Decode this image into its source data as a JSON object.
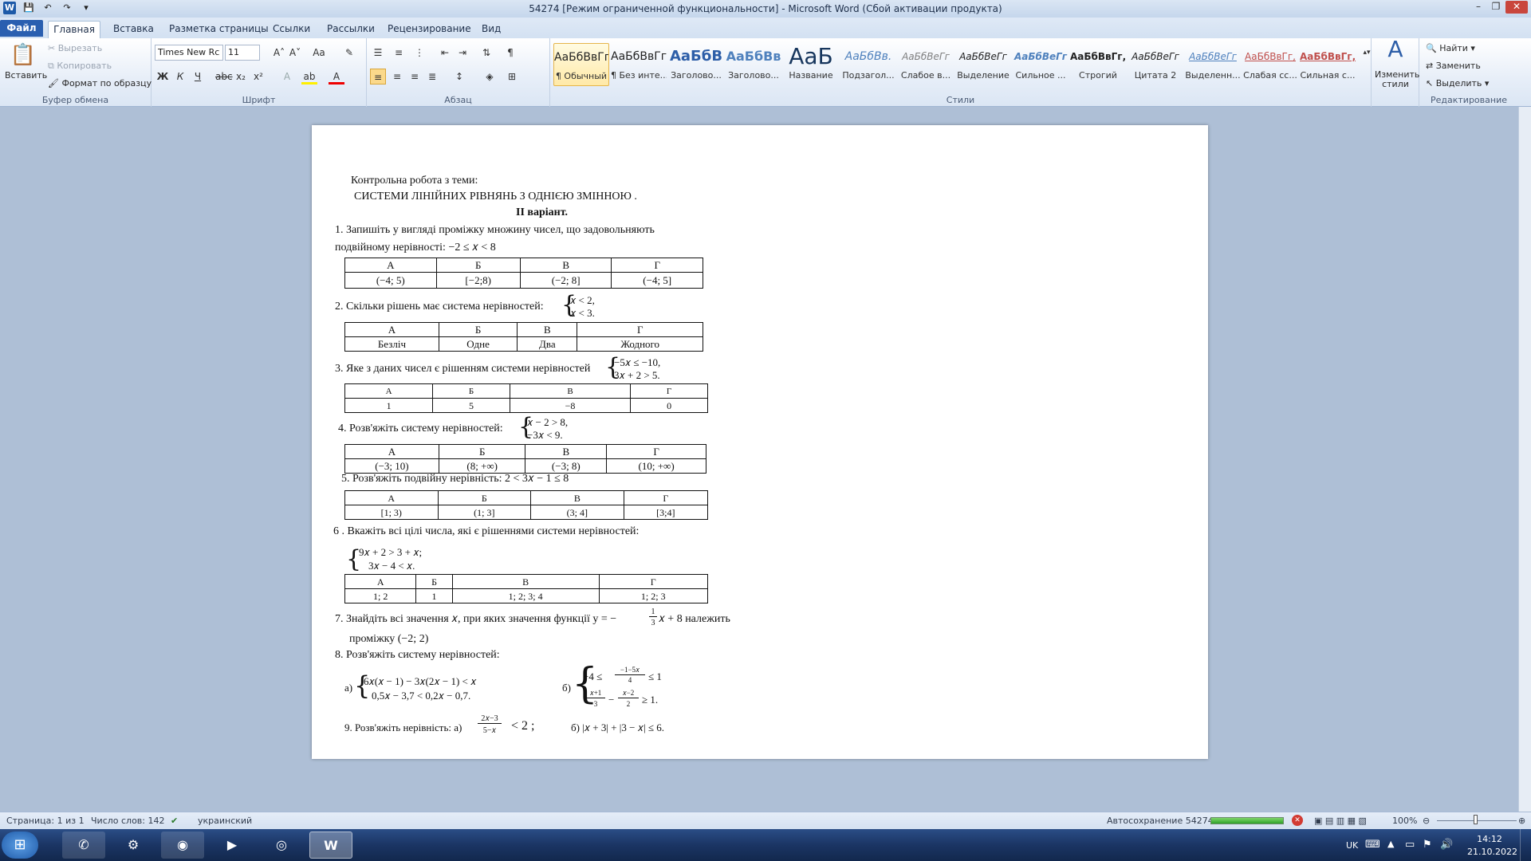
{
  "window": {
    "title": "54274 [Режим ограниченной функциональности] - Microsoft Word (Сбой активации продукта)"
  },
  "tabs": [
    "Файл",
    "Главная",
    "Вставка",
    "Разметка страницы",
    "Ссылки",
    "Рассылки",
    "Рецензирование",
    "Вид"
  ],
  "clipboard": {
    "paste": "Вставить",
    "cut": "Вырезать",
    "copy": "Копировать",
    "format": "Формат по образцу",
    "label": "Буфер обмена"
  },
  "font": {
    "name": "Times New Rc",
    "size": "11",
    "label": "Шрифт"
  },
  "paragraph": {
    "label": "Абзац"
  },
  "styles": {
    "label": "Стили",
    "items": [
      {
        "preview": "АаБбВвГг,",
        "name": "¶ Обычный"
      },
      {
        "preview": "АаБбВвГг,",
        "name": "¶ Без инте..."
      },
      {
        "preview": "АаБбВ",
        "name": "Заголово..."
      },
      {
        "preview": "АаБбВв",
        "name": "Заголово..."
      },
      {
        "preview": "АаБ",
        "name": "Название"
      },
      {
        "preview": "АаБбВв.",
        "name": "Подзагол..."
      },
      {
        "preview": "АаБбВеГг",
        "name": "Слабое в..."
      },
      {
        "preview": "АаБбВеГг",
        "name": "Выделение"
      },
      {
        "preview": "АаБбВеГг",
        "name": "Сильное ..."
      },
      {
        "preview": "АаБбВвГг,",
        "name": "Строгий"
      },
      {
        "preview": "АаБбВеГг",
        "name": "Цитата 2"
      },
      {
        "preview": "АаБбВеГг",
        "name": "Выделенн..."
      },
      {
        "preview": "АаБбВвГг,",
        "name": "Слабая сс..."
      },
      {
        "preview": "АаБбВвГг,",
        "name": "Сильная с..."
      }
    ],
    "change": "Изменить стили"
  },
  "editing": {
    "find": "Найти",
    "replace": "Заменить",
    "select": "Выделить",
    "label": "Редактирование"
  },
  "doc": {
    "l1": "Контрольна робота з теми:",
    "l2": "СИСТЕМИ ЛІНІЙНИХ РІВНЯНЬ З ОДНІЄЮ  ЗМІННОЮ .",
    "l3": "ІІ варіант.",
    "q1a": "1. Запишіть у вигляді проміжку множину чисел, що задовольняють",
    "q1b": "подвійному нерівності:   −2 ≤ 𝑥 < 8",
    "headers": [
      "А",
      "Б",
      "В",
      "Г"
    ],
    "t1": [
      "(−4; 5)",
      "[−2;8)",
      "(−2; 8]",
      "(−4; 5]"
    ],
    "q2": "2. Скільки рішень має система нерівностей:",
    "q2s": [
      "𝑥 < 2,",
      "𝑥 < 3."
    ],
    "t2": [
      "Безліч",
      "Одне",
      "Два",
      "Жодного"
    ],
    "q3": "3. Яке з даних чисел є рішенням системи нерівностей",
    "q3s": [
      "−5𝑥 ≤ −10,",
      "3𝑥 + 2 > 5."
    ],
    "t3": [
      "1",
      "5",
      "−8",
      "0"
    ],
    "q4": "4. Розв'яжіть систему нерівностей:",
    "q4s": [
      "𝑥 − 2 > 8,",
      "−3𝑥 < 9."
    ],
    "t4": [
      "(−3; 10)",
      "(8; +∞)",
      "(−3; 8)",
      "(10; +∞)"
    ],
    "q5": "5. Розв'яжіть подвійну нерівність:  2 < 3𝑥 − 1 ≤ 8",
    "t5": [
      "[1; 3)",
      "(1; 3]",
      "(3; 4]",
      "[3;4]"
    ],
    "q6": "6 . Вкажіть всі цілі числа, які є рішеннями системи нерівностей:",
    "q6s": [
      "9𝑥 + 2 > 3 + 𝑥;",
      "3𝑥 − 4 < 𝑥."
    ],
    "t6": [
      "1; 2",
      "1",
      "1; 2; 3; 4",
      "1; 2; 3"
    ],
    "q7a": "7.   Знайдіть всі значення 𝑥, при яких значення функції  y = −",
    "q7frac": [
      "1",
      "3"
    ],
    "q7b": "𝑥 + 8   належить",
    "q7c": "проміжку (−2; 2)",
    "q8": "8. Розв'яжіть систему нерівностей:",
    "q8a_label": "а)",
    "q8a": [
      "6𝑥(𝑥 − 1) − 3𝑥(2𝑥 − 1) < 𝑥",
      "0,5𝑥 − 3,7 < 0,2𝑥 − 0,7."
    ],
    "q8b_label": "б)",
    "q8b1_pre": "−4 ≤",
    "q8b1_num": "−1−5𝑥",
    "q8b1_den": "4",
    "q8b1_post": "≤ 1",
    "q8b2_n1": "𝑥+1",
    "q8b2_d1": "3",
    "q8b2_mid": "−",
    "q8b2_n2": "𝑥−2",
    "q8b2_d2": "2",
    "q8b2_post": "≥ 1.",
    "q9": "9. Розв'яжіть нерівність: а)",
    "q9num": "2𝑥−3",
    "q9den": "5−𝑥",
    "q9post": "< 2 ;",
    "q9b": "б)  |𝑥 + 3| + |3 − 𝑥| ≤ 6."
  },
  "status": {
    "page": "Страница: 1 из 1",
    "words": "Число слов: 142",
    "lang": "украинский",
    "autosave": "Автосохранение 54274:",
    "zoom": "100%"
  },
  "taskbar": {
    "lang": "UK",
    "time": "14:12",
    "date": "21.10.2022"
  }
}
